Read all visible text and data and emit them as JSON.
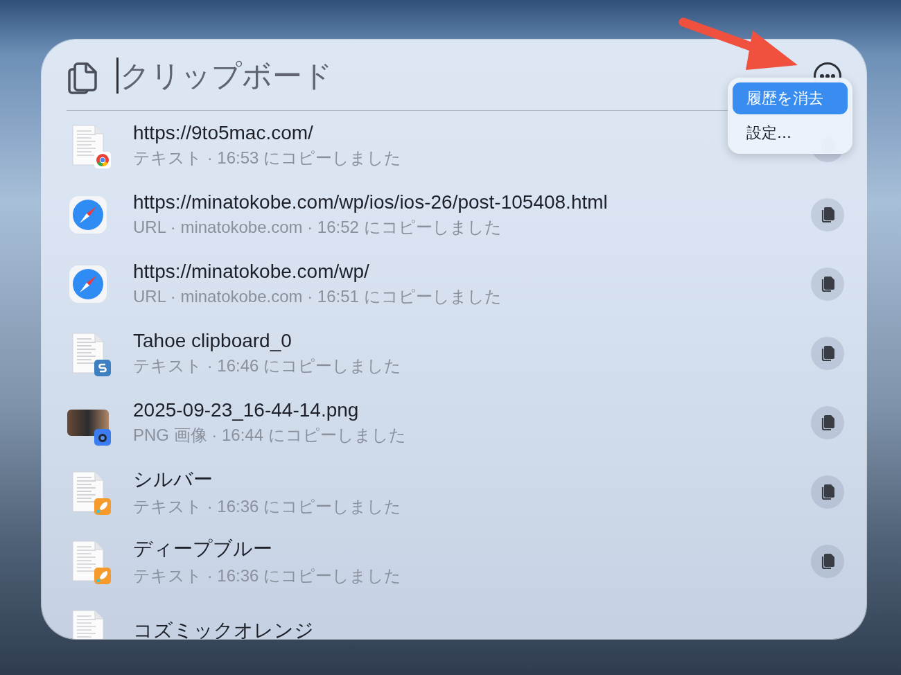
{
  "search": {
    "placeholder": "クリップボード"
  },
  "menu": {
    "items": [
      {
        "label": "履歴を消去",
        "selected": true
      },
      {
        "label": "設定...",
        "selected": false
      }
    ]
  },
  "items": [
    {
      "title": "https://9to5mac.com/",
      "subtitle": "テキスト · 16:53 にコピーしました",
      "kind": "document",
      "badge": {
        "kind": "chrome"
      }
    },
    {
      "title": "https://minatokobe.com/wp/ios/ios-26/post-105408.html",
      "subtitle": "URL · minatokobe.com · 16:52 にコピーしました",
      "kind": "compass"
    },
    {
      "title": "https://minatokobe.com/wp/",
      "subtitle": "URL · minatokobe.com · 16:51 にコピーしました",
      "kind": "compass"
    },
    {
      "title": "Tahoe clipboard_0",
      "subtitle": "テキスト · 16:46 にコピーしました",
      "kind": "document",
      "badge": {
        "kind": "letter-s"
      }
    },
    {
      "title": "2025-09-23_16-44-14.png",
      "subtitle": "PNG 画像 · 16:44 にコピーしました",
      "kind": "image",
      "badge": {
        "kind": "camera"
      }
    },
    {
      "title": "シルバー",
      "subtitle": "テキスト · 16:36 にコピーしました",
      "kind": "document",
      "badge": {
        "kind": "rocket"
      }
    },
    {
      "title": "ディープブルー",
      "subtitle": "テキスト · 16:36 にコピーしました",
      "kind": "document",
      "badge": {
        "kind": "rocket"
      }
    },
    {
      "title": "コズミックオレンジ",
      "kind": "document"
    }
  ]
}
